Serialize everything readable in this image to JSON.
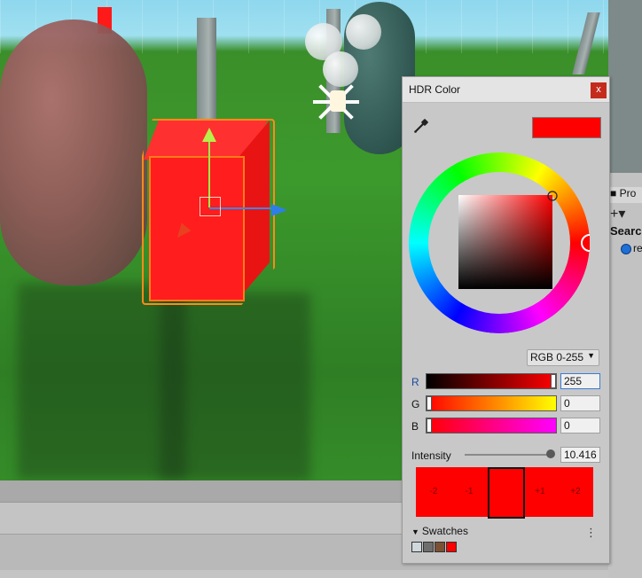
{
  "hdr_window": {
    "title": "HDR Color",
    "close_label": "x",
    "current_color": "#ff0000",
    "mode": "RGB 0-255",
    "mode_arrow": "▼",
    "channels": [
      {
        "label": "R",
        "value": "255",
        "level": 1.0,
        "gradient": [
          "#000000",
          "#ff0000"
        ],
        "label_color": "#1a4a9e"
      },
      {
        "label": "G",
        "value": "0",
        "level": 0.0,
        "gradient": [
          "#ff0000",
          "#ffff00"
        ],
        "label_color": "#111111"
      },
      {
        "label": "B",
        "value": "0",
        "level": 0.0,
        "gradient": [
          "#ff0000",
          "#ff00ff"
        ],
        "label_color": "#111111"
      }
    ],
    "intensity_label": "Intensity",
    "intensity_value": "10.416",
    "exposure_stops": [
      "-2",
      "-1",
      "",
      "+1",
      "+2"
    ],
    "swatches_label": "Swatches",
    "swatches_menu": "⋮",
    "swatch_colors": [
      "#cfd8dd",
      "#6e6e6e",
      "#7b5034",
      "#ff0000"
    ]
  },
  "project_panel": {
    "tab_label": "Pro",
    "add_label": "+▾",
    "search_label": "Search",
    "item_label": "re"
  },
  "icons": [
    "eyedropper-icon",
    "close-icon",
    "chevron-down-icon",
    "foldout-triangle-icon",
    "more-options-icon",
    "directional-light-icon",
    "folder-icon",
    "add-icon"
  ]
}
